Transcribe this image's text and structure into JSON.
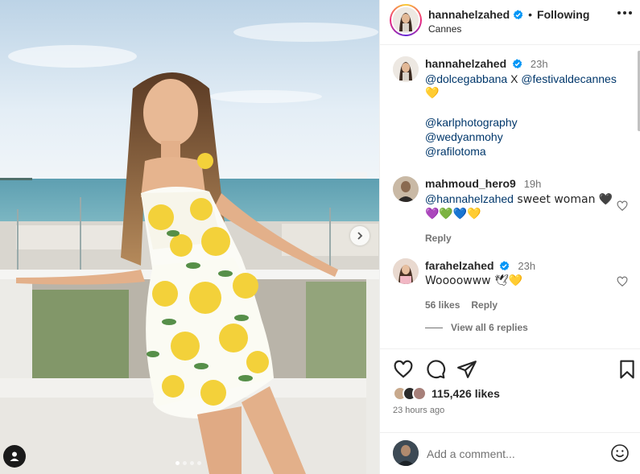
{
  "post": {
    "username": "hannahelzahed",
    "verified": true,
    "follow_separator": "•",
    "follow_status": "Following",
    "location": "Cannes",
    "more_icon": "more-horizontal-icon"
  },
  "caption": {
    "username": "hannahelzahed",
    "time": "23h",
    "mention_1": "@dolcegabbana",
    "joiner": " X ",
    "mention_2": "@festivaldecannes",
    "emoji": "💛",
    "credit_1": "@karlphotography",
    "credit_2": "@wedyanmohy",
    "credit_3": "@rafilotoma"
  },
  "comments": [
    {
      "username": "mahmoud_hero9",
      "time": "19h",
      "mention": "@hannahelzahed",
      "text": " sweet woman 🖤",
      "line2": "💜💚💙💛",
      "reply_label": "Reply"
    },
    {
      "username": "farahelzahed",
      "verified": true,
      "time": "23h",
      "text": "Woooowww 🕊💛",
      "likes_label": "56 likes",
      "reply_label": "Reply"
    }
  ],
  "view_replies": "View all 6 replies",
  "stats": {
    "likes": "115,426 likes",
    "time_ago": "23 hours ago"
  },
  "add_comment": {
    "placeholder": "Add a comment..."
  },
  "carousel": {
    "count": 4,
    "active_index": 0
  },
  "colors": {
    "mention": "#00376b",
    "verified": "#0095f6",
    "secondary_text": "#737373"
  }
}
